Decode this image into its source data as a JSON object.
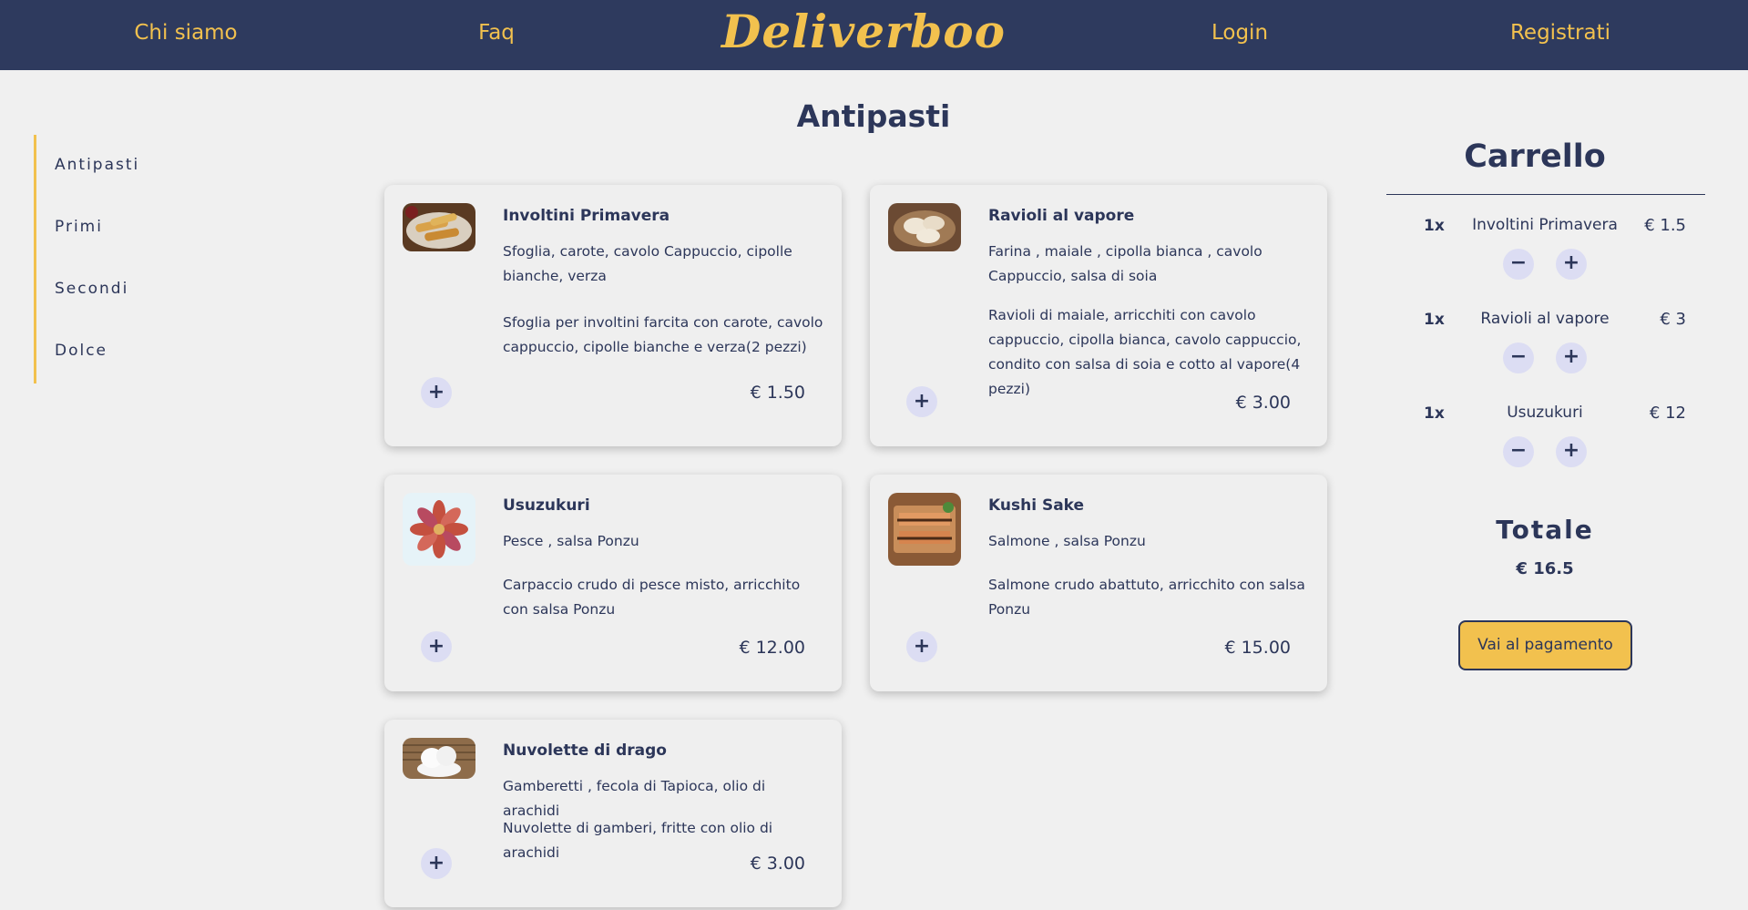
{
  "nav": {
    "about": "Chi siamo",
    "faq": "Faq",
    "logo": "Deliverboo",
    "login": "Login",
    "register": "Registrati"
  },
  "sidebar": {
    "items": [
      {
        "label": "Antipasti"
      },
      {
        "label": "Primi"
      },
      {
        "label": "Secondi"
      },
      {
        "label": "Dolce"
      }
    ]
  },
  "menu": {
    "title": "Antipasti",
    "dishes": [
      {
        "name": "Involtini Primavera",
        "ingredients": "Sfoglia, carote, cavolo Cappuccio, cipolle bianche, verza",
        "description": "Sfoglia per involtini farcita con carote, cavolo cappuccio, cipolle bianche e verza(2 pezzi)",
        "price": "€ 1.50",
        "image": "spring-rolls-photo"
      },
      {
        "name": "Ravioli al vapore",
        "ingredients": "Farina , maiale , cipolla bianca , cavolo Cappuccio, salsa di soia",
        "description": "Ravioli di maiale, arricchiti con cavolo cappuccio, cipolla bianca, cavolo cappuccio, condito con salsa di soia e cotto al vapore(4 pezzi)",
        "price": "€ 3.00",
        "image": "dumplings-photo"
      },
      {
        "name": "Usuzukuri",
        "ingredients": "Pesce , salsa Ponzu",
        "description": "Carpaccio crudo di pesce misto, arricchito con salsa Ponzu",
        "price": "€ 12.00",
        "image": "fish-carpaccio-photo"
      },
      {
        "name": "Kushi Sake",
        "ingredients": "Salmone , salsa Ponzu",
        "description": "Salmone crudo abattuto, arricchito con salsa Ponzu",
        "price": "€ 15.00",
        "image": "salmon-skewer-photo"
      },
      {
        "name": "Nuvolette di drago",
        "ingredients": "Gamberetti , fecola di Tapioca, olio di arachidi",
        "description": "Nuvolette di gamberi, fritte con olio di arachidi",
        "price": "€ 3.00",
        "image": "prawn-crackers-photo"
      }
    ],
    "add_symbol": "+"
  },
  "cart": {
    "title": "Carrello",
    "items": [
      {
        "qty": "1x",
        "name": "Involtini Primavera",
        "price": "€ 1.5"
      },
      {
        "qty": "1x",
        "name": "Ravioli al vapore",
        "price": "€ 3"
      },
      {
        "qty": "1x",
        "name": "Usuzukuri",
        "price": "€ 12"
      }
    ],
    "minus_symbol": "−",
    "plus_symbol": "+",
    "total_label": "Totale",
    "total_value": "€ 16.5",
    "checkout_label": "Vai al pagamento"
  },
  "colors": {
    "navbar": "#2e3a5e",
    "accent": "#f2c14e",
    "text": "#2c3659",
    "button_bg": "#dcddf3",
    "page_bg": "#f0f0f0"
  }
}
